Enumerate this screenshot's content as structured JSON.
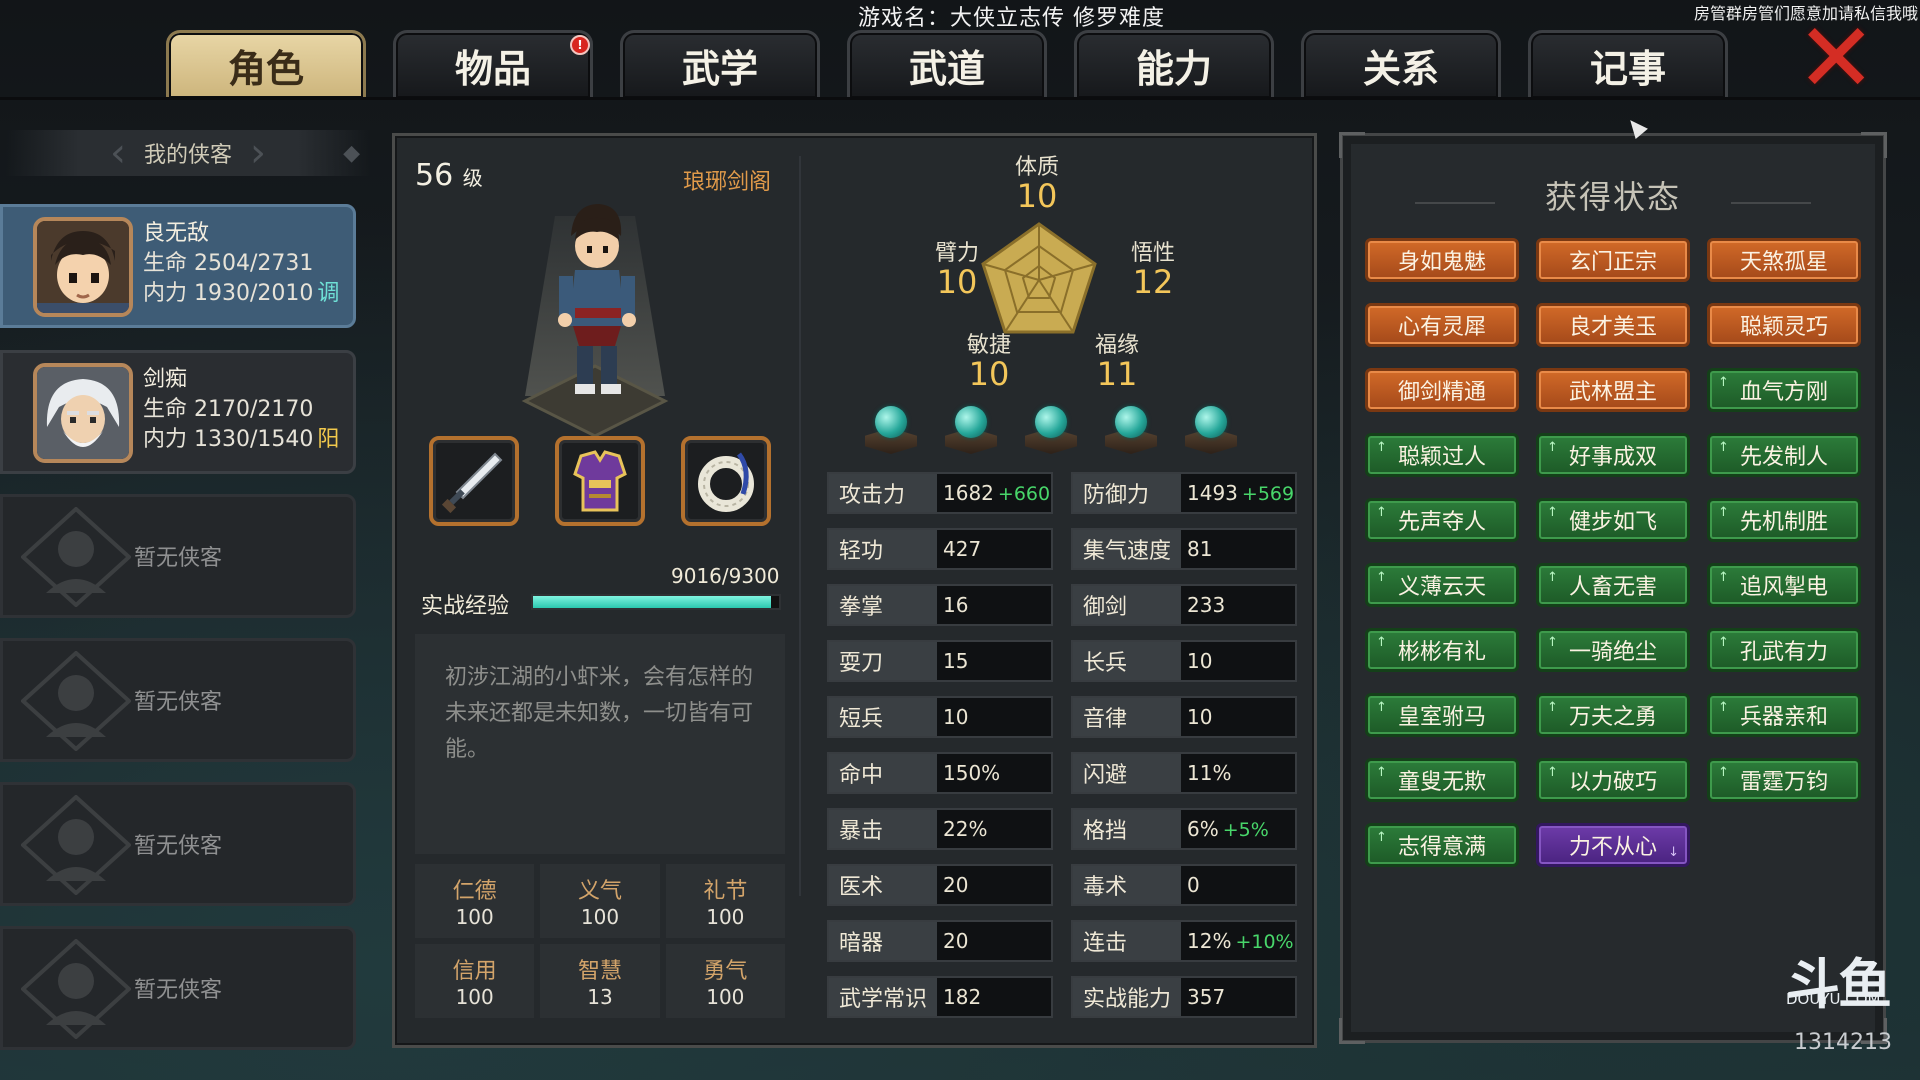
{
  "header": {
    "game_caption": "游戏名：大侠立志传 修罗难度",
    "stream_caption": "房管群房管们愿意加请私信我哦"
  },
  "tabs": [
    {
      "label": "角色",
      "active": true
    },
    {
      "label": "物品",
      "badge": "!"
    },
    {
      "label": "武学"
    },
    {
      "label": "武道"
    },
    {
      "label": "能力"
    },
    {
      "label": "关系"
    },
    {
      "label": "记事"
    }
  ],
  "roster": {
    "title": "我的侠客",
    "heroes": [
      {
        "name": "良无敌",
        "life": "生命 2504/2731",
        "mp": "内力 1930/2010",
        "tag": "调"
      },
      {
        "name": "剑痴",
        "life": "生命 2170/2170",
        "mp": "内力 1330/1540",
        "tag": "阳"
      }
    ],
    "empty_slots": [
      "暂无侠客",
      "暂无侠客",
      "暂无侠客",
      "暂无侠客"
    ]
  },
  "character": {
    "level": "56",
    "level_unit": "级",
    "sect": "琅琊剑阁",
    "exp_label": "实战经验",
    "exp_value": "9016/9300",
    "exp_fraction": 0.9695,
    "bio": "初涉江湖的小虾米，会有怎样的未来还都是未知数，一切皆有可能。",
    "virtues": [
      {
        "name": "仁德",
        "value": "100"
      },
      {
        "name": "义气",
        "value": "100"
      },
      {
        "name": "礼节",
        "value": "100"
      },
      {
        "name": "信用",
        "value": "100"
      },
      {
        "name": "智慧",
        "value": "13"
      },
      {
        "name": "勇气",
        "value": "100"
      }
    ],
    "attributes": [
      {
        "name": "体质",
        "value": "10"
      },
      {
        "name": "悟性",
        "value": "12"
      },
      {
        "name": "福缘",
        "value": "11"
      },
      {
        "name": "敏捷",
        "value": "10"
      },
      {
        "name": "臂力",
        "value": "10"
      }
    ],
    "equipment_icons": [
      "sword-icon",
      "armor-icon",
      "jade-ring-icon"
    ]
  },
  "stats": [
    {
      "name": "攻击力",
      "value": "1682",
      "bonus": "+660"
    },
    {
      "name": "防御力",
      "value": "1493",
      "bonus": "+569"
    },
    {
      "name": "轻功",
      "value": "427"
    },
    {
      "name": "集气速度",
      "value": "81"
    },
    {
      "name": "拳掌",
      "value": "16"
    },
    {
      "name": "御剑",
      "value": "233"
    },
    {
      "name": "耍刀",
      "value": "15"
    },
    {
      "name": "长兵",
      "value": "10"
    },
    {
      "name": "短兵",
      "value": "10"
    },
    {
      "name": "音律",
      "value": "10"
    },
    {
      "name": "命中",
      "value": "150%"
    },
    {
      "name": "闪避",
      "value": "11%"
    },
    {
      "name": "暴击",
      "value": "22%"
    },
    {
      "name": "格挡",
      "value": "6%",
      "bonus": "+5%"
    },
    {
      "name": "医术",
      "value": "20"
    },
    {
      "name": "毒术",
      "value": "0"
    },
    {
      "name": "暗器",
      "value": "20"
    },
    {
      "name": "连击",
      "value": "12%",
      "bonus": "+10%"
    },
    {
      "name": "武学常识",
      "value": "182"
    },
    {
      "name": "实战能力",
      "value": "357"
    }
  ],
  "status_panel": {
    "title": "获得状态",
    "items": [
      {
        "label": "身如鬼魅",
        "color": "orange"
      },
      {
        "label": "玄门正宗",
        "color": "orange"
      },
      {
        "label": "天煞孤星",
        "color": "orange"
      },
      {
        "label": "心有灵犀",
        "color": "orange"
      },
      {
        "label": "良才美玉",
        "color": "orange"
      },
      {
        "label": "聪颖灵巧",
        "color": "orange"
      },
      {
        "label": "御剑精通",
        "color": "orange"
      },
      {
        "label": "武林盟主",
        "color": "orange"
      },
      {
        "label": "血气方刚",
        "color": "green"
      },
      {
        "label": "聪颖过人",
        "color": "green"
      },
      {
        "label": "好事成双",
        "color": "green"
      },
      {
        "label": "先发制人",
        "color": "green"
      },
      {
        "label": "先声夺人",
        "color": "green"
      },
      {
        "label": "健步如飞",
        "color": "green"
      },
      {
        "label": "先机制胜",
        "color": "green"
      },
      {
        "label": "义薄云天",
        "color": "green"
      },
      {
        "label": "人畜无害",
        "color": "green"
      },
      {
        "label": "追风掣电",
        "color": "green"
      },
      {
        "label": "彬彬有礼",
        "color": "green"
      },
      {
        "label": "一骑绝尘",
        "color": "green"
      },
      {
        "label": "孔武有力",
        "color": "green"
      },
      {
        "label": "皇室驸马",
        "color": "green"
      },
      {
        "label": "万夫之勇",
        "color": "green"
      },
      {
        "label": "兵器亲和",
        "color": "green"
      },
      {
        "label": "童叟无欺",
        "color": "green"
      },
      {
        "label": "以力破巧",
        "color": "green"
      },
      {
        "label": "雷霆万钧",
        "color": "green"
      },
      {
        "label": "志得意满",
        "color": "green"
      },
      {
        "label": "力不从心",
        "color": "purple"
      }
    ]
  },
  "watermark": {
    "logo": "斗鱼",
    "site": "DOUYU.COM",
    "room_id": "1314213"
  },
  "colors": {
    "tab_active": "#cdb57c",
    "status_orange": "#c05a22",
    "status_green": "#2a7436",
    "status_purple": "#5e2f97",
    "bonus_green": "#48d66a",
    "exp_bar": "#2bc9b0"
  }
}
